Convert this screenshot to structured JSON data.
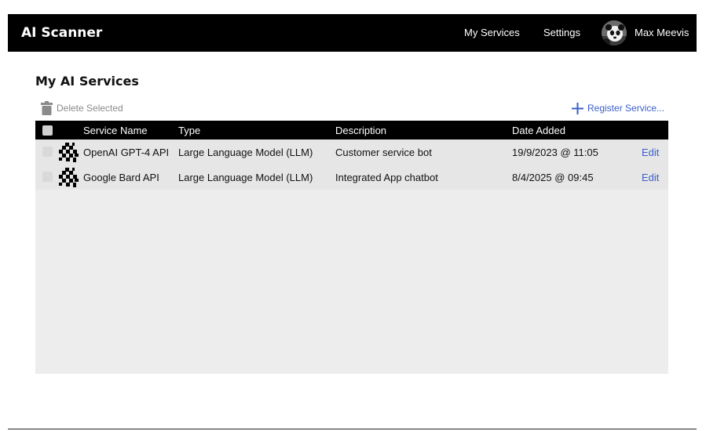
{
  "app": {
    "title": "AI Scanner"
  },
  "nav": {
    "my_services": "My Services",
    "settings": "Settings",
    "user_name": "Max Meevis"
  },
  "page": {
    "title": "My AI Services"
  },
  "toolbar": {
    "delete_label": "Delete Selected",
    "register_label": "Register Service..."
  },
  "table": {
    "headers": {
      "name": "Service Name",
      "type": "Type",
      "description": "Description",
      "date": "Date Added"
    },
    "rows": [
      {
        "name": "OpenAI GPT-4 API",
        "type": "Large Language Model (LLM)",
        "description": "Customer service bot",
        "date": "19/9/2023 @ 11:05",
        "edit": "Edit"
      },
      {
        "name": "Google Bard API",
        "type": "Large Language Model (LLM)",
        "description": "Integrated App chatbot",
        "date": "8/4/2025 @ 09:45",
        "edit": "Edit"
      }
    ]
  },
  "colors": {
    "header_bg": "#000000",
    "link": "#3a5fcd",
    "table_bg": "#ededed",
    "row_bg": "#e6e6e6"
  }
}
